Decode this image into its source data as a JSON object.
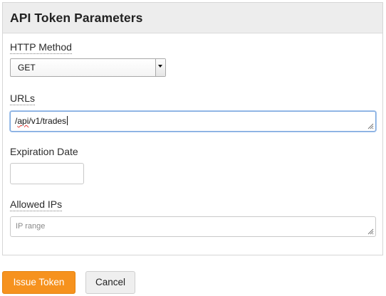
{
  "panel": {
    "title": "API Token Parameters"
  },
  "http_method": {
    "label": "HTTP Method",
    "selected": "GET"
  },
  "urls": {
    "label": "URLs",
    "value_prefix": "/",
    "value_misspelled": "api",
    "value_suffix": "/v1/trades"
  },
  "expiration_date": {
    "label": "Expiration Date",
    "value": ""
  },
  "allowed_ips": {
    "label": "Allowed IPs",
    "placeholder": "IP range"
  },
  "actions": {
    "issue_label": "Issue Token",
    "cancel_label": "Cancel"
  },
  "colors": {
    "primary_button": "#f6921e",
    "focus_border": "#7aa6dd",
    "header_bg": "#ededed"
  }
}
